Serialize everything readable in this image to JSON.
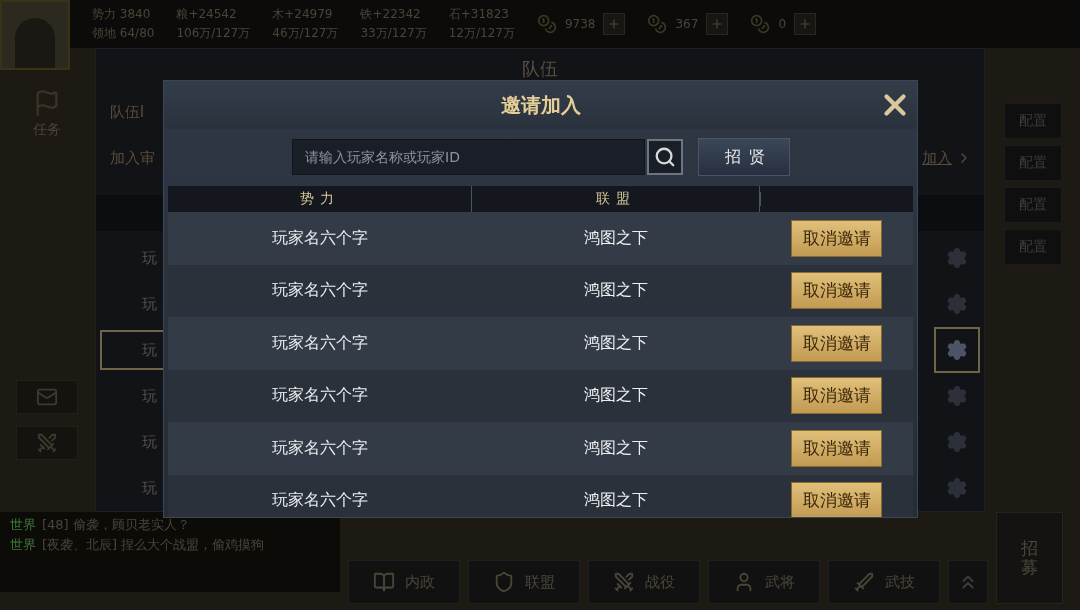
{
  "top_bar": {
    "player_stats": [
      "势力 3840",
      "领地 64/80"
    ],
    "resources": [
      {
        "gain": "粮+24542",
        "stock": "106万/127万"
      },
      {
        "gain": "木+24979",
        "stock": "46万/127万"
      },
      {
        "gain": "铁+22342",
        "stock": "33万/127万"
      },
      {
        "gain": "石+31823",
        "stock": "12万/127万"
      }
    ],
    "currencies": [
      {
        "amount": "9738"
      },
      {
        "amount": "367"
      },
      {
        "amount": "0"
      }
    ]
  },
  "left_rail": {
    "task_label": "任务"
  },
  "team_panel": {
    "title": "队伍",
    "id_label": "队伍I",
    "review_label": "加入审",
    "join_link": "加入",
    "members": [
      {
        "name": "玩",
        "selected": false
      },
      {
        "name": "玩",
        "selected": false
      },
      {
        "name": "玩",
        "selected": true
      },
      {
        "name": "玩",
        "selected": false
      },
      {
        "name": "玩",
        "selected": false
      },
      {
        "name": "玩",
        "selected": false
      }
    ]
  },
  "config_buttons": [
    "配置",
    "配置",
    "配置",
    "配置"
  ],
  "chat": [
    {
      "channel": "世界",
      "sender": "[48]",
      "message": "偷袭，顾贝老实人？"
    },
    {
      "channel": "世界",
      "sender": "[夜袭、北辰]",
      "message": "捏么大个战盟，偷鸡摸狗"
    }
  ],
  "nav": [
    "内政",
    "联盟",
    "战役",
    "武将",
    "武技"
  ],
  "recruit_label": "招募",
  "dialog": {
    "title": "邀请加入",
    "search": {
      "placeholder": "请输入玩家名称或玩家ID"
    },
    "recruit_button": "招贤",
    "columns": [
      "势力",
      "联盟"
    ],
    "rows": [
      {
        "faction": "玩家名六个字",
        "alliance": "鸿图之下",
        "action": "取消邀请"
      },
      {
        "faction": "玩家名六个字",
        "alliance": "鸿图之下",
        "action": "取消邀请"
      },
      {
        "faction": "玩家名六个字",
        "alliance": "鸿图之下",
        "action": "取消邀请"
      },
      {
        "faction": "玩家名六个字",
        "alliance": "鸿图之下",
        "action": "取消邀请"
      },
      {
        "faction": "玩家名六个字",
        "alliance": "鸿图之下",
        "action": "取消邀请"
      },
      {
        "faction": "玩家名六个字",
        "alliance": "鸿图之下",
        "action": "取消邀请"
      }
    ]
  }
}
